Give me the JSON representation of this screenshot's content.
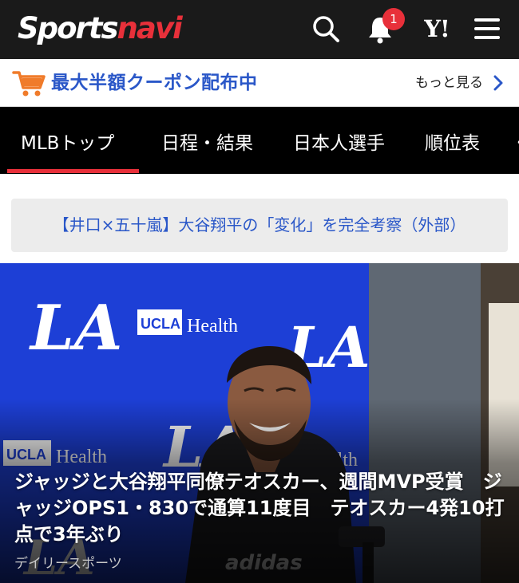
{
  "header": {
    "logo_white": "Sports",
    "logo_red": "navi",
    "notification_count": "1",
    "yahoo_label": "Y!",
    "icons": [
      "search-icon",
      "bell-icon",
      "yahoo-icon",
      "menu-icon"
    ]
  },
  "coupon": {
    "text": "最大半額クーポン配布中",
    "more_label": "もっと見る",
    "icon": "cart-icon"
  },
  "tabs": [
    {
      "label": "MLBトップ",
      "active": true
    },
    {
      "label": "日程・結果",
      "active": false
    },
    {
      "label": "日本人選手",
      "active": false
    },
    {
      "label": "順位表",
      "active": false
    },
    {
      "label": "く",
      "active": false
    }
  ],
  "notice": {
    "text": "【井口×五十嵐】大谷翔平の「変化」を完全考察（外部）"
  },
  "hero": {
    "headline": "ジャッジと大谷翔平同僚テオスカー、週間MVP受賞　ジャッジOPS1・830で通算11度目　テオスカー4発10打点で3年ぶり",
    "source": "デイリースポーツ",
    "backdrop_logo": "LA",
    "backdrop_sponsor_badge": "UCLA",
    "backdrop_sponsor_text": "Health",
    "jersey_text": "adidas"
  },
  "colors": {
    "header_bg": "#1a1a1a",
    "accent_red": "#e8303a",
    "link_blue": "#2a57c8",
    "tab_bg": "#000000",
    "dodger_blue": "#1d3fd6"
  }
}
